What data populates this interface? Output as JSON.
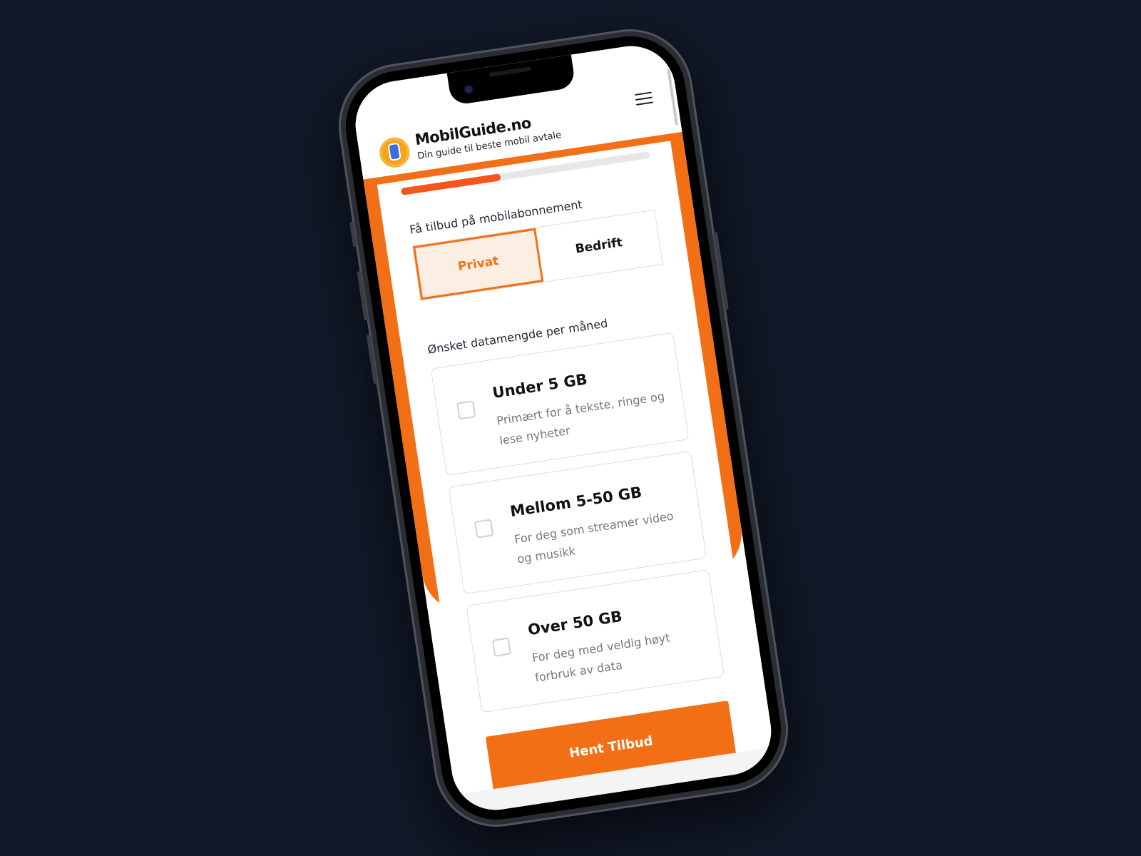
{
  "header": {
    "brand_name": "MobilGuide.no",
    "tagline": "Din guide til beste mobil avtale",
    "logo_icon": "phone-logo-icon",
    "menu_icon": "hamburger-menu-icon"
  },
  "form": {
    "progress_percent": 40,
    "customer_type_label": "Få tilbud på mobilabonnement",
    "customer_types": [
      {
        "label": "Privat",
        "selected": true
      },
      {
        "label": "Bedrift",
        "selected": false
      }
    ],
    "data_label": "Ønsket datamengde per måned",
    "data_options": [
      {
        "title": "Under 5 GB",
        "description": "Primært for å tekste, ringe og lese nyheter",
        "checked": false
      },
      {
        "title": "Mellom 5-50 GB",
        "description": "For deg som streamer video og musikk",
        "checked": false
      },
      {
        "title": "Over 50 GB",
        "description": "For deg med veldig høyt forbruk av data",
        "checked": false
      }
    ],
    "submit_label": "Hent Tilbud"
  },
  "colors": {
    "background": "#111827",
    "accent": "#f36f16",
    "progress": "#f4551a",
    "selected_fill": "#fdeee4"
  }
}
